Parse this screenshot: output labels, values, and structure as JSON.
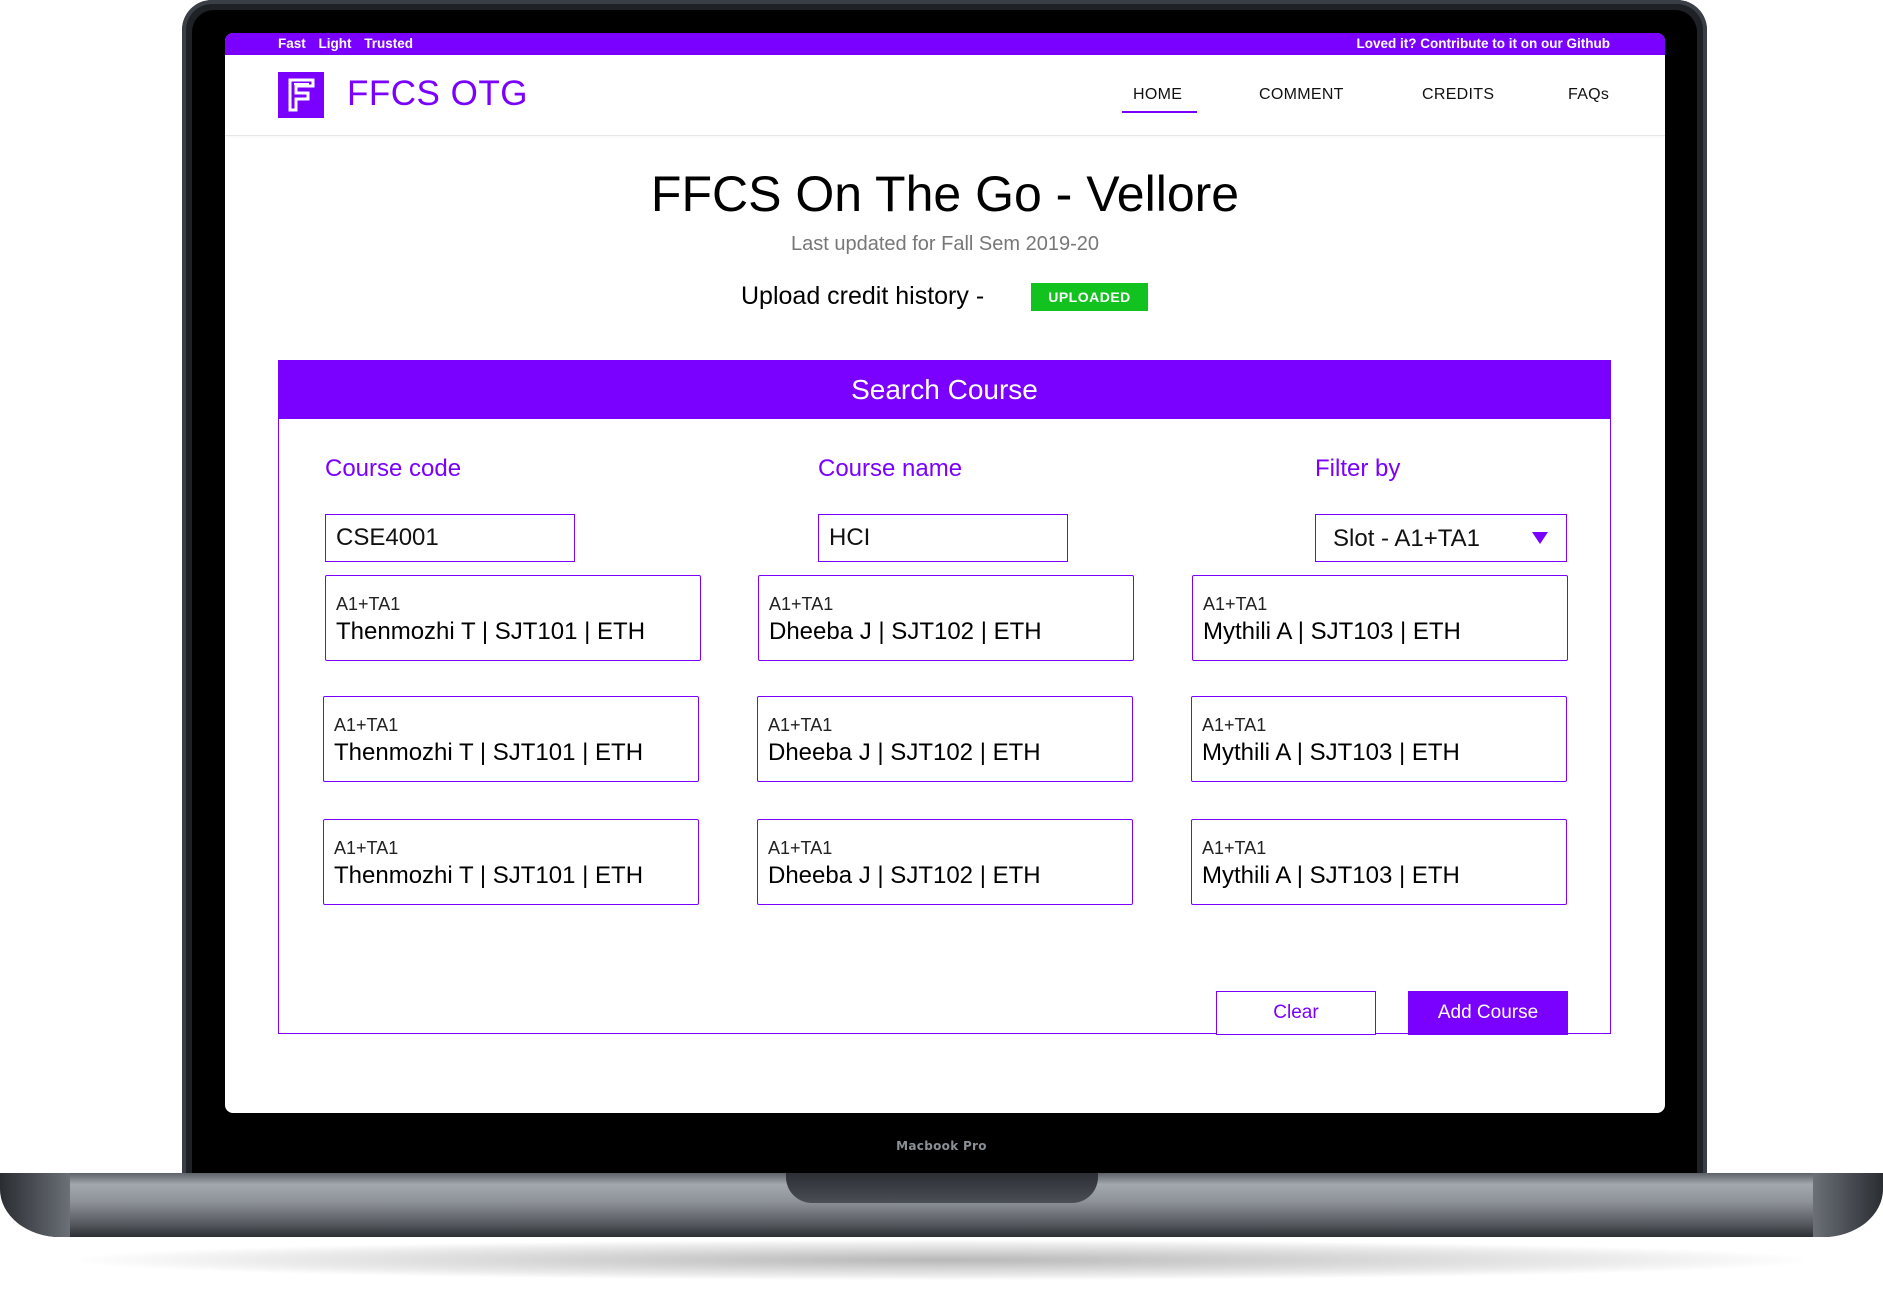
{
  "device": {
    "label": "Macbook Pro"
  },
  "topbar": {
    "tags": [
      "Fast",
      "Light",
      "Trusted"
    ],
    "right_text": "Loved it? Contribute to it on our Github"
  },
  "navbar": {
    "app_name": "FFCS OTG",
    "logo_icon": "ffcs-logo-icon",
    "items": [
      {
        "label": "HOME",
        "active": true
      },
      {
        "label": "COMMENT",
        "active": false
      },
      {
        "label": "CREDITS",
        "active": false
      },
      {
        "label": "FAQs",
        "active": false
      }
    ]
  },
  "hero": {
    "title": "FFCS On The Go - Vellore",
    "subtitle": "Last updated for Fall Sem 2019-20",
    "upload_label": "Upload credit history -",
    "upload_status": "UPLOADED"
  },
  "search": {
    "header": "Search Course",
    "course_code_label": "Course code",
    "course_code_value": "CSE4001",
    "course_name_label": "Course name",
    "course_name_value": "HCI",
    "filter_label": "Filter by",
    "filter_value": "Slot - A1+TA1"
  },
  "results": [
    {
      "slot": "A1+TA1",
      "info": "Thenmozhi T | SJT101 | ETH"
    },
    {
      "slot": "A1+TA1",
      "info": "Dheeba J | SJT102 | ETH"
    },
    {
      "slot": "A1+TA1",
      "info": "Mythili A | SJT103 | ETH"
    },
    {
      "slot": "A1+TA1",
      "info": "Thenmozhi T | SJT101 | ETH"
    },
    {
      "slot": "A1+TA1",
      "info": "Dheeba J | SJT102 | ETH"
    },
    {
      "slot": "A1+TA1",
      "info": "Mythili A | SJT103 | ETH"
    },
    {
      "slot": "A1+TA1",
      "info": "Thenmozhi T | SJT101 | ETH"
    },
    {
      "slot": "A1+TA1",
      "info": "Dheeba J | SJT102 | ETH"
    },
    {
      "slot": "A1+TA1",
      "info": "Mythili A | SJT103 | ETH"
    }
  ],
  "actions": {
    "clear_label": "Clear",
    "add_label": "Add Course"
  },
  "colors": {
    "accent": "#7a00ff",
    "status_success": "#12c21e"
  }
}
